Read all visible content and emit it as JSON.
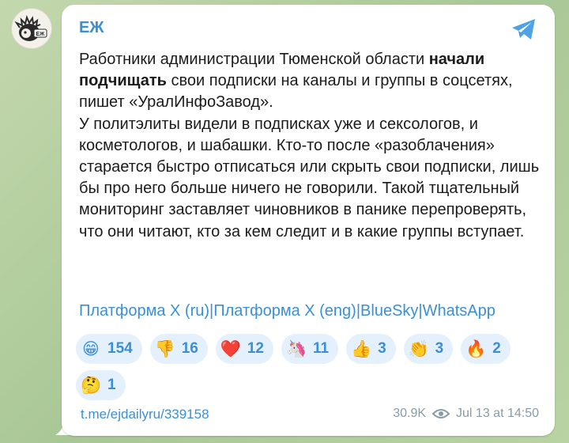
{
  "avatar": {
    "badge": "ЕЖ"
  },
  "channel": {
    "name": "ЕЖ"
  },
  "message": {
    "p1_a": "Работники администрации Тюменской области ",
    "p1_bold": "начали подчищать",
    "p1_b": " свои подписки на каналы и группы в соцсетях, пишет «УралИнфоЗавод».",
    "p2": "У политэлиты видели в подписках уже и сексологов, и косметологов, и шабашки. Кто-то после «разоблачения» старается быстро отписаться или скрыть свои подписки, лишь бы про него больше ничего не говорили. Такой тщательный мониторинг заставляет чиновников в панике перепроверять, что они читают, кто за кем следит и в какие группы вступает."
  },
  "links": [
    {
      "label": "Платформа X (ru)"
    },
    {
      "label": "Платформа X (eng)"
    },
    {
      "label": "BlueSky"
    },
    {
      "label": "WhatsApp"
    }
  ],
  "separator": "|",
  "reactions": [
    {
      "emoji": "😁",
      "icon": "grin-emoji",
      "count": "154"
    },
    {
      "emoji": "👎",
      "icon": "thumbs-down-emoji",
      "count": "16"
    },
    {
      "emoji": "❤️",
      "icon": "heart-emoji",
      "count": "12"
    },
    {
      "emoji": "🦄",
      "icon": "unicorn-emoji",
      "count": "11"
    },
    {
      "emoji": "👍",
      "icon": "thumbs-up-emoji",
      "count": "3"
    },
    {
      "emoji": "👏",
      "icon": "clap-emoji",
      "count": "3"
    },
    {
      "emoji": "🔥",
      "icon": "fire-emoji",
      "count": "2"
    },
    {
      "emoji": "🤔",
      "icon": "thinking-emoji",
      "count": "1"
    }
  ],
  "footer": {
    "link": "t.me/ejdailyru/339158",
    "views": "30.9K",
    "timestamp": "Jul 13 at 14:50"
  },
  "colors": {
    "accent": "#3a8fd6",
    "reaction_bg": "#e4f0fb",
    "text": "#1b1b1b",
    "meta": "#8a9aa6"
  }
}
